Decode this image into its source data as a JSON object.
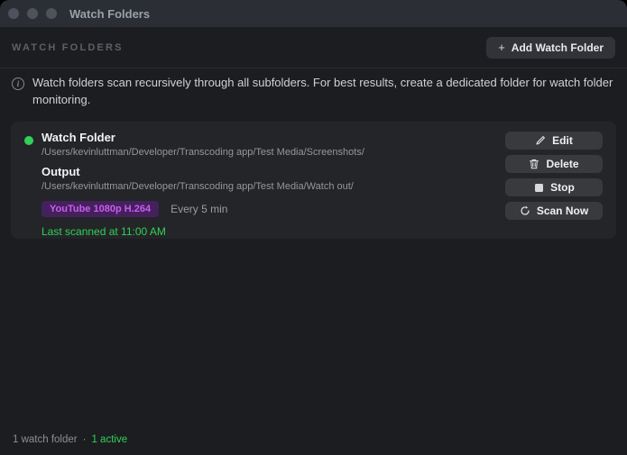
{
  "window": {
    "title": "Watch Folders"
  },
  "header": {
    "section_label": "WATCH FOLDERS",
    "add_button_label": "Add Watch Folder",
    "add_button_icon": "+"
  },
  "info": {
    "icon_glyph": "i",
    "text": "Watch folders scan recursively through all subfolders. For best results, create a dedicated folder for watch folder monitoring."
  },
  "watch_folder_card": {
    "status": "active",
    "source_label": "Watch Folder",
    "source_path": "/Users/kevinluttman/Developer/Transcoding app/Test Media/Screenshots/",
    "output_label": "Output",
    "output_path": "/Users/kevinluttman/Developer/Transcoding app/Test Media/Watch out/",
    "preset_badge": "YouTube 1080p H.264",
    "interval": "Every 5 min",
    "last_scanned": "Last scanned at 11:00 AM",
    "buttons": [
      {
        "label": "Edit",
        "icon": "pencil-icon"
      },
      {
        "label": "Delete",
        "icon": "trash-icon"
      },
      {
        "label": "Stop",
        "icon": "stop-icon"
      },
      {
        "label": "Scan Now",
        "icon": "refresh-icon"
      }
    ]
  },
  "footer": {
    "count_label": "1 watch folder",
    "separator": "·",
    "active_label": "1 active"
  },
  "colors": {
    "accent_green": "#30d158",
    "badge_purple_text": "#c95df0",
    "badge_purple_bg": "#44215c",
    "titlebar_bg": "#2b2e35",
    "card_bg": "#242528",
    "page_bg": "#1c1d20"
  }
}
